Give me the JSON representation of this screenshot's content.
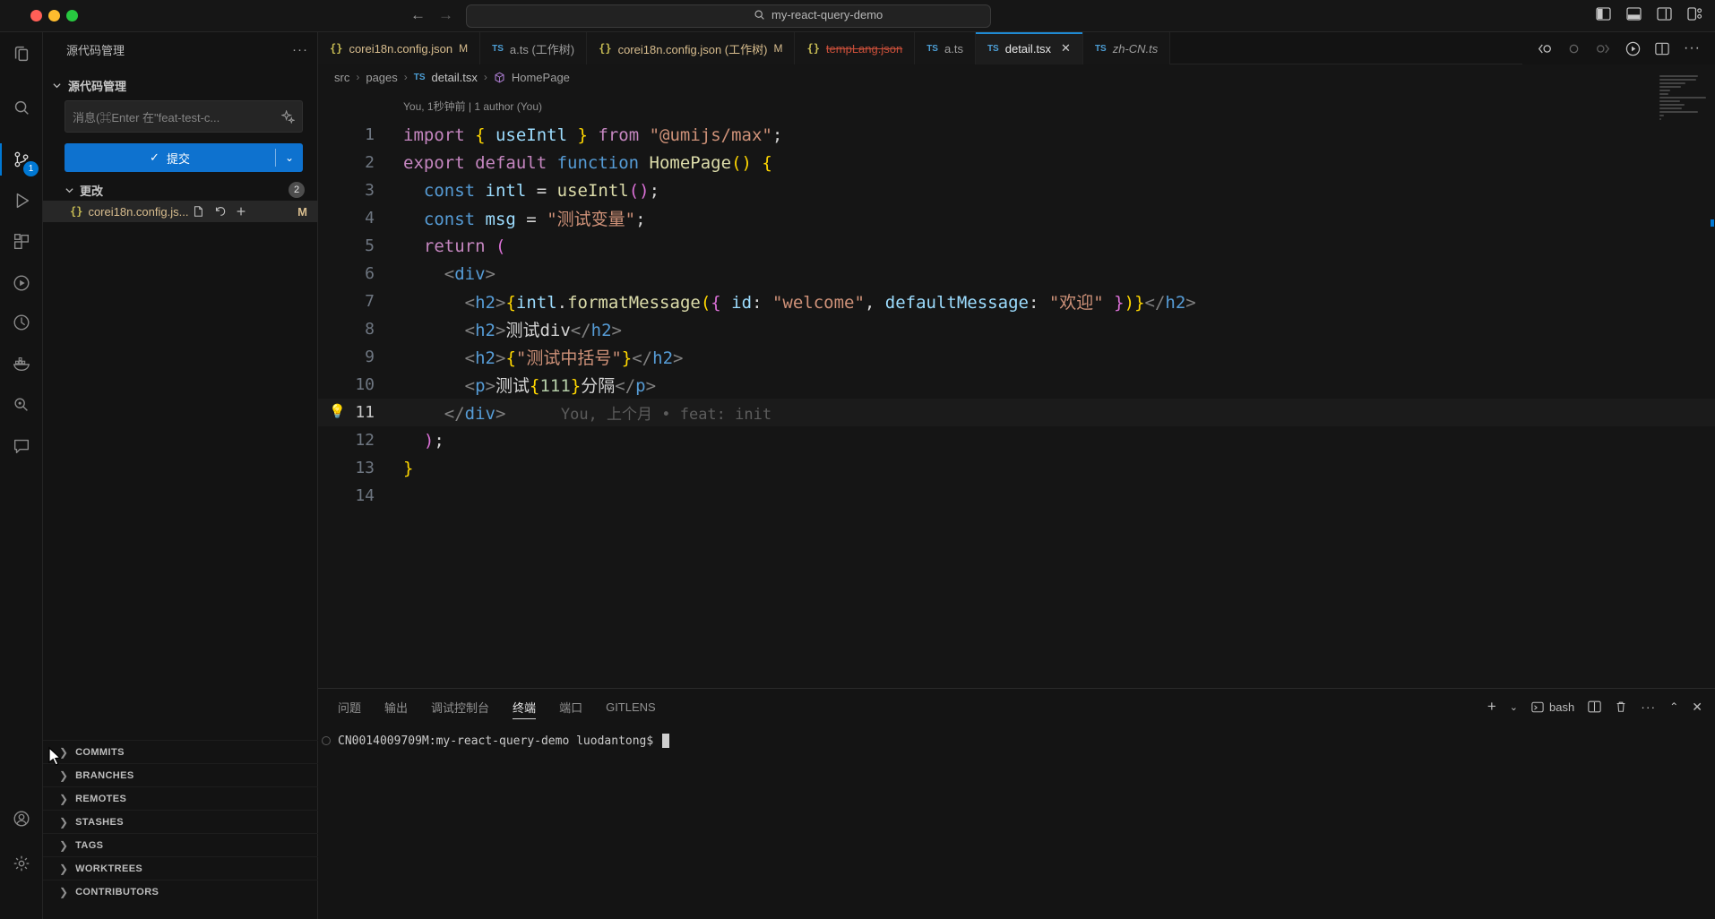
{
  "colors": {
    "accent": "#0078d4",
    "modified": "#E2C08D",
    "deleted": "#c74e39",
    "tab_border": "#1f8ad2"
  },
  "window": {
    "search_value": "my-react-query-demo"
  },
  "sidebar": {
    "title": "源代码管理",
    "section_title": "源代码管理",
    "message_placeholder": "消息(⌘Enter 在\"feat-test-c...",
    "commit_label": "提交",
    "changes_label": "更改",
    "changes_count": "2",
    "file_name": "corei18n.config.js...",
    "file_badge": "M",
    "gitlens_sections": [
      "COMMITS",
      "BRANCHES",
      "REMOTES",
      "STASHES",
      "TAGS",
      "WORKTREES",
      "CONTRIBUTORS"
    ]
  },
  "tabs": [
    {
      "kind": "json",
      "label": "corei18n.config.json",
      "badge": "M",
      "state": "modified"
    },
    {
      "kind": "ts",
      "label": "a.ts (工作树)",
      "state": "normal"
    },
    {
      "kind": "json",
      "label": "corei18n.config.json (工作树)",
      "badge": "M",
      "state": "modified"
    },
    {
      "kind": "json",
      "label": "tempLang.json",
      "state": "deleted"
    },
    {
      "kind": "ts",
      "label": "a.ts",
      "state": "normal"
    },
    {
      "kind": "ts",
      "label": "detail.tsx",
      "state": "normal",
      "active": true,
      "close": "✕"
    },
    {
      "kind": "ts",
      "label": "zh-CN.ts",
      "state": "normal",
      "italic": true
    }
  ],
  "breadcrumb": {
    "items": [
      "src",
      "pages",
      "detail.tsx",
      "HomePage"
    ]
  },
  "codelens": "You, 1秒钟前 | 1 author (You)",
  "code": {
    "blame": "You, 上个月 • feat: init",
    "lines": [
      {
        "n": 1,
        "tokens": [
          [
            "k",
            "import "
          ],
          [
            "g1",
            "{"
          ],
          [
            "v",
            " useIntl "
          ],
          [
            "g1",
            "}"
          ],
          [
            "k",
            " from "
          ],
          [
            "s",
            "\"@umijs/max\""
          ],
          [
            "p",
            ";"
          ]
        ]
      },
      {
        "n": 2,
        "tokens": [
          [
            "k",
            "export default "
          ],
          [
            "b",
            "function "
          ],
          [
            "f",
            "HomePage"
          ],
          [
            "g1",
            "()"
          ],
          [
            "p",
            " "
          ],
          [
            "g1",
            "{"
          ]
        ]
      },
      {
        "n": 3,
        "tokens": [
          [
            "p",
            "  "
          ],
          [
            "b",
            "const "
          ],
          [
            "v",
            "intl "
          ],
          [
            "p",
            "= "
          ],
          [
            "f",
            "useIntl"
          ],
          [
            "g2",
            "()"
          ],
          [
            "p",
            ";"
          ]
        ]
      },
      {
        "n": 4,
        "tokens": [
          [
            "p",
            "  "
          ],
          [
            "b",
            "const "
          ],
          [
            "v",
            "msg "
          ],
          [
            "p",
            "= "
          ],
          [
            "s",
            "\"测试变量\""
          ],
          [
            "p",
            ";"
          ]
        ]
      },
      {
        "n": 5,
        "tokens": [
          [
            "p",
            "  "
          ],
          [
            "k",
            "return "
          ],
          [
            "g2",
            "("
          ]
        ]
      },
      {
        "n": 6,
        "tokens": [
          [
            "p",
            "    "
          ],
          [
            "a",
            "<"
          ],
          [
            "t",
            "div"
          ],
          [
            "a",
            ">"
          ]
        ]
      },
      {
        "n": 7,
        "tokens": [
          [
            "p",
            "      "
          ],
          [
            "a",
            "<"
          ],
          [
            "t",
            "h2"
          ],
          [
            "a",
            ">"
          ],
          [
            "g1",
            "{"
          ],
          [
            "v",
            "intl"
          ],
          [
            "p",
            "."
          ],
          [
            "f",
            "formatMessage"
          ],
          [
            "g1",
            "("
          ],
          [
            "g2",
            "{"
          ],
          [
            "v",
            " id"
          ],
          [
            "p",
            ": "
          ],
          [
            "s",
            "\"welcome\""
          ],
          [
            "p",
            ", "
          ],
          [
            "v",
            "defaultMessage"
          ],
          [
            "p",
            ": "
          ],
          [
            "s",
            "\"欢迎\""
          ],
          [
            "g2",
            " }"
          ],
          [
            "g1",
            ")}"
          ],
          [
            "a",
            "</"
          ],
          [
            "t",
            "h2"
          ],
          [
            "a",
            ">"
          ]
        ]
      },
      {
        "n": 8,
        "tokens": [
          [
            "p",
            "      "
          ],
          [
            "a",
            "<"
          ],
          [
            "t",
            "h2"
          ],
          [
            "a",
            ">"
          ],
          [
            "p",
            "测试div"
          ],
          [
            "a",
            "</"
          ],
          [
            "t",
            "h2"
          ],
          [
            "a",
            ">"
          ]
        ]
      },
      {
        "n": 9,
        "tokens": [
          [
            "p",
            "      "
          ],
          [
            "a",
            "<"
          ],
          [
            "t",
            "h2"
          ],
          [
            "a",
            ">"
          ],
          [
            "g1",
            "{"
          ],
          [
            "s",
            "\"测试中括号\""
          ],
          [
            "g1",
            "}"
          ],
          [
            "a",
            "</"
          ],
          [
            "t",
            "h2"
          ],
          [
            "a",
            ">"
          ]
        ]
      },
      {
        "n": 10,
        "tokens": [
          [
            "p",
            "      "
          ],
          [
            "a",
            "<"
          ],
          [
            "t",
            "p"
          ],
          [
            "a",
            ">"
          ],
          [
            "p",
            "测试"
          ],
          [
            "g1",
            "{"
          ],
          [
            "n2",
            "111"
          ],
          [
            "g1",
            "}"
          ],
          [
            "p",
            "分隔"
          ],
          [
            "a",
            "</"
          ],
          [
            "t",
            "p"
          ],
          [
            "a",
            ">"
          ]
        ]
      },
      {
        "n": 11,
        "current": true,
        "bulb": true,
        "tokens": [
          [
            "p",
            "    "
          ],
          [
            "a",
            "</"
          ],
          [
            "t",
            "div"
          ],
          [
            "a",
            ">"
          ],
          [
            "cm",
            "      You, 上个月 • feat: init"
          ]
        ]
      },
      {
        "n": 12,
        "tokens": [
          [
            "p",
            "  "
          ],
          [
            "g2",
            ")"
          ],
          [
            "p",
            ";"
          ]
        ]
      },
      {
        "n": 13,
        "tokens": [
          [
            "g1",
            "}"
          ]
        ]
      },
      {
        "n": 14,
        "tokens": []
      }
    ]
  },
  "panel": {
    "tabs": [
      "问题",
      "输出",
      "调试控制台",
      "终端",
      "端口",
      "GITLENS"
    ],
    "active_index": 3,
    "shell_label": "bash",
    "prompt": "CN0014009709M:my-react-query-demo luodantong$"
  }
}
